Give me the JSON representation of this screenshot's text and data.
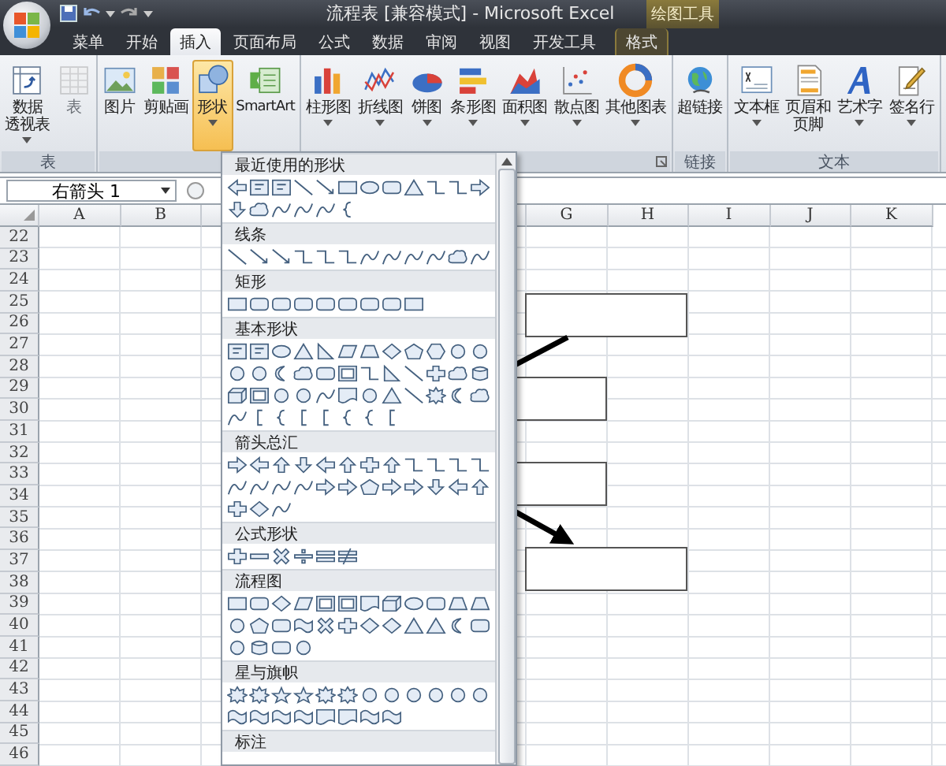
{
  "window": {
    "title": "流程表 [兼容模式] - Microsoft Excel",
    "context_group": "绘图工具"
  },
  "tabs": [
    {
      "label": "菜单",
      "selected": false,
      "kind": "normal"
    },
    {
      "label": "开始",
      "selected": false,
      "kind": "normal"
    },
    {
      "label": "插入",
      "selected": true,
      "kind": "normal"
    },
    {
      "label": "页面布局",
      "selected": false,
      "kind": "normal"
    },
    {
      "label": "公式",
      "selected": false,
      "kind": "normal"
    },
    {
      "label": "数据",
      "selected": false,
      "kind": "normal"
    },
    {
      "label": "审阅",
      "selected": false,
      "kind": "normal"
    },
    {
      "label": "视图",
      "selected": false,
      "kind": "normal"
    },
    {
      "label": "开发工具",
      "selected": false,
      "kind": "normal"
    },
    {
      "label": "格式",
      "selected": false,
      "kind": "contextual"
    }
  ],
  "ribbon": {
    "groups": [
      {
        "label": "表",
        "launcher": false,
        "buttons": [
          {
            "lines": [
              "数据",
              "透视表"
            ],
            "dropdown": true,
            "disabled": false,
            "pressed": false
          },
          {
            "label": "表",
            "dropdown": false,
            "disabled": true,
            "pressed": false
          }
        ]
      },
      {
        "launcher": false,
        "buttons": [
          {
            "label": "图片",
            "dropdown": false,
            "disabled": false,
            "pressed": false
          },
          {
            "label": "剪贴画",
            "dropdown": false,
            "disabled": false,
            "pressed": false
          },
          {
            "label": "形状",
            "dropdown": true,
            "disabled": false,
            "pressed": true
          },
          {
            "label": "SmartArt",
            "dropdown": false,
            "disabled": false,
            "pressed": false
          }
        ]
      },
      {
        "launcher": true,
        "buttons": [
          {
            "label": "柱形图",
            "dropdown": true,
            "disabled": false,
            "pressed": false
          },
          {
            "label": "折线图",
            "dropdown": true,
            "disabled": false,
            "pressed": false
          },
          {
            "label": "饼图",
            "dropdown": true,
            "disabled": false,
            "pressed": false
          },
          {
            "label": "条形图",
            "dropdown": true,
            "disabled": false,
            "pressed": false
          },
          {
            "label": "面积图",
            "dropdown": true,
            "disabled": false,
            "pressed": false
          },
          {
            "label": "散点图",
            "dropdown": true,
            "disabled": false,
            "pressed": false
          },
          {
            "label": "其他图表",
            "dropdown": true,
            "disabled": false,
            "pressed": false
          }
        ]
      },
      {
        "label": "链接",
        "launcher": false,
        "buttons": [
          {
            "label": "超链接",
            "dropdown": false,
            "disabled": false,
            "pressed": false
          }
        ]
      },
      {
        "label": "文本",
        "launcher": false,
        "buttons": [
          {
            "label": "文本框",
            "dropdown": true,
            "disabled": false,
            "pressed": false
          },
          {
            "lines": [
              "页眉和",
              "页脚"
            ],
            "dropdown": false,
            "disabled": false,
            "pressed": false
          },
          {
            "label": "艺术字",
            "dropdown": true,
            "disabled": false,
            "pressed": false
          },
          {
            "label": "签名行",
            "dropdown": true,
            "disabled": false,
            "pressed": false
          }
        ]
      }
    ]
  },
  "name_box": {
    "value": "右箭头 1"
  },
  "sheet": {
    "columns_left": [
      "A",
      "B"
    ],
    "columns_right": [
      "G",
      "H",
      "I",
      "J",
      "K"
    ],
    "rows": [
      "22",
      "23",
      "24",
      "25",
      "26",
      "27",
      "28",
      "29",
      "30",
      "31",
      "32",
      "33",
      "34",
      "35",
      "36",
      "37",
      "38",
      "39",
      "40",
      "41",
      "42",
      "43",
      "44",
      "45",
      "46"
    ]
  },
  "shapes_menu": {
    "sections": [
      {
        "title": "最近使用的形状"
      },
      {
        "title": "线条"
      },
      {
        "title": "矩形"
      },
      {
        "title": "基本形状"
      },
      {
        "title": "箭头总汇"
      },
      {
        "title": "公式形状"
      },
      {
        "title": "流程图"
      },
      {
        "title": "星与旗帜"
      },
      {
        "title": "标注"
      }
    ]
  }
}
